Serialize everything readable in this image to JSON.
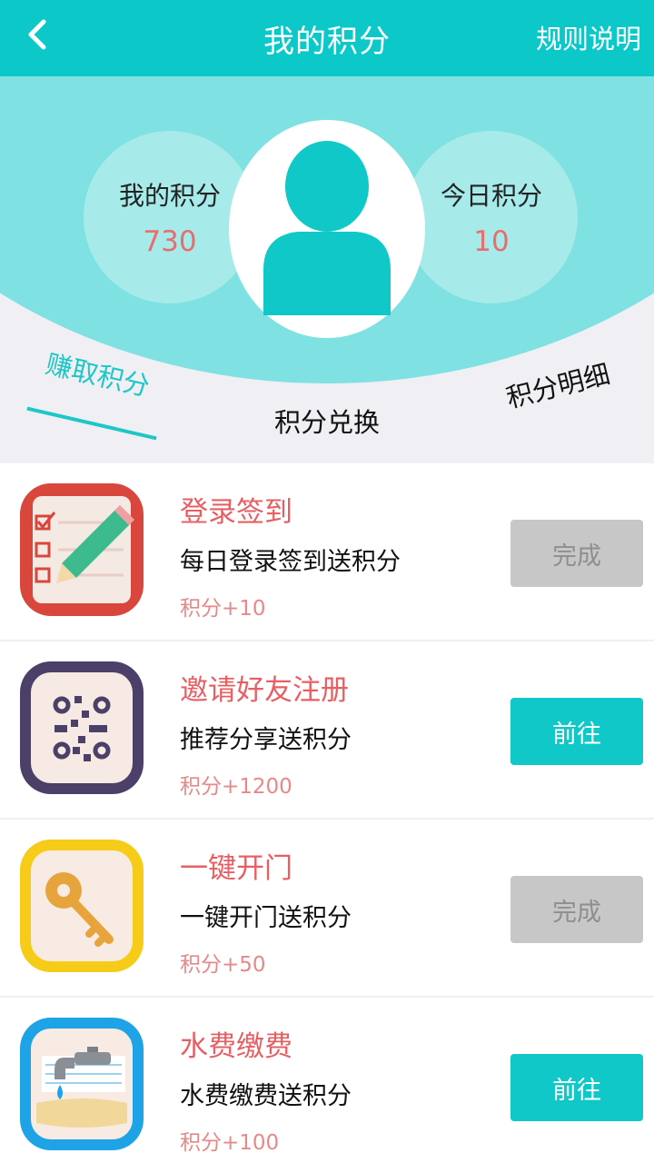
{
  "header": {
    "title": "我的积分",
    "rules_label": "规则说明"
  },
  "profile": {
    "my_points_label": "我的积分",
    "my_points_value": "730",
    "today_points_label": "今日积分",
    "today_points_value": "10"
  },
  "tabs": [
    {
      "label": "赚取积分",
      "active": true
    },
    {
      "label": "积分兑换",
      "active": false
    },
    {
      "label": "积分明细",
      "active": false
    }
  ],
  "tasks": [
    {
      "icon": "checklist-pencil-icon",
      "name": "登录签到",
      "desc": "每日登录签到送积分",
      "points": "积分+10",
      "button": "完成",
      "status": "done"
    },
    {
      "icon": "qr-code-icon",
      "name": "邀请好友注册",
      "desc": "推荐分享送积分",
      "points": "积分+1200",
      "button": "前往",
      "status": "go"
    },
    {
      "icon": "key-icon",
      "name": "一键开门",
      "desc": "一键开门送积分",
      "points": "积分+50",
      "button": "完成",
      "status": "done"
    },
    {
      "icon": "water-tap-icon",
      "name": "水费缴费",
      "desc": "水费缴费送积分",
      "points": "积分+100",
      "button": "前往",
      "status": "go"
    }
  ],
  "colors": {
    "accent": "#0cc8c8",
    "light_accent": "#7fe1e1",
    "points_red": "#e85f63",
    "done_gray": "#c7c7c7"
  }
}
